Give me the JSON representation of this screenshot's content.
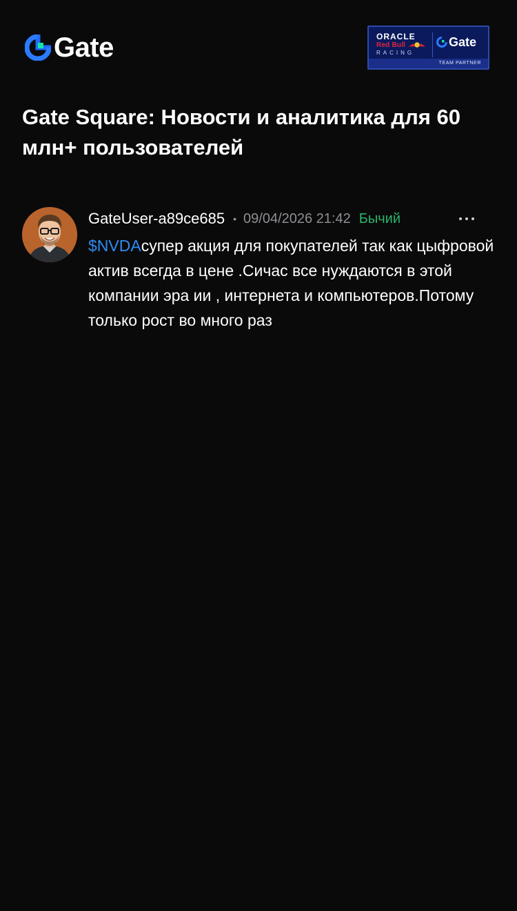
{
  "header": {
    "logo_text": "Gate",
    "logo_icon": "gate-logo-icon",
    "partner_badge": {
      "oracle": "ORACLE",
      "redbull": "Red Bull",
      "racing": "RACING",
      "gate": "Gate",
      "footer": "TEAM PARTNER"
    }
  },
  "page_title": "Gate Square: Новости и аналитика для 60 млн+ пользователей",
  "post": {
    "username": "GateUser-a89ce685",
    "separator": "•",
    "timestamp": "09/04/2026 21:42",
    "sentiment": "Бычий",
    "ticker": "$NVDA",
    "body": "супер акция для покупателей так как цыфровой актив всегда в цене .Сичас все нуждаются в этой компании эра ии , интернета и компьютеров.Потому только рост во много раз",
    "more_icon": "more-dots-icon",
    "colors": {
      "ticker": "#2f8cf5",
      "sentiment": "#2bb46a",
      "timestamp": "#8f8f93"
    }
  },
  "colors": {
    "background": "#0a0a0b",
    "text": "#ffffff",
    "brand_blue": "#1f6bff",
    "brand_green": "#17e6a1"
  }
}
